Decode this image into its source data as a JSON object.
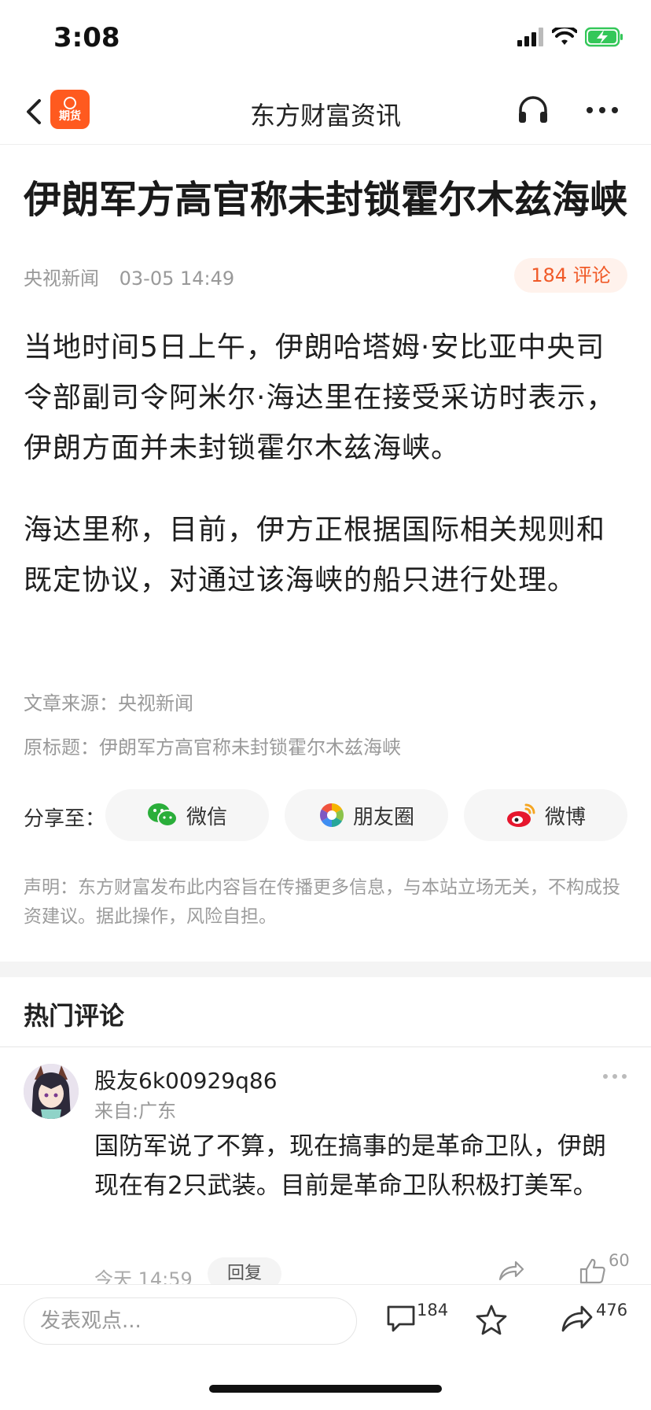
{
  "status_bar": {
    "time": "3:08"
  },
  "nav": {
    "logo_label": "期货",
    "title": "东方财富资讯"
  },
  "article": {
    "title": "伊朗军方高官称未封锁霍尔木兹海峡",
    "source": "央视新闻",
    "datetime": "03-05 14:49",
    "comments_label": "184 评论",
    "paragraphs": [
      "当地时间5日上午，伊朗哈塔姆·安比亚中央司令部副司令阿米尔·海达里在接受采访时表示，伊朗方面并未封锁霍尔木兹海峡。",
      "海达里称，目前，伊方正根据国际相关规则和既定协议，对通过该海峡的船只进行处理。"
    ],
    "source_line": "文章来源：央视新闻",
    "original_title_line": "原标题：伊朗军方高官称未封锁霍尔木兹海峡"
  },
  "share": {
    "label": "分享至：",
    "wechat": "微信",
    "moments": "朋友圈",
    "weibo": "微博"
  },
  "disclaimer": "声明：东方财富发布此内容旨在传播更多信息，与本站立场无关，不构成投资建议。据此操作，风险自担。",
  "hot_comments": {
    "title": "热门评论",
    "items": [
      {
        "user": "股友6k00929q86",
        "location": "来自:广东",
        "text": "国防军说了不算，现在搞事的是革命卫队，伊朗现在有2只武装。目前是革命卫队积极打美军。",
        "time": "今天 14:59",
        "reply_label": "回复",
        "likes": "60"
      }
    ]
  },
  "bottom_bar": {
    "input_placeholder": "发表观点...",
    "comment_count": "184",
    "share_count": "476"
  },
  "colors": {
    "accent": "#f05a28",
    "logo_bg": "#ff5a1f",
    "battery": "#34c759"
  }
}
